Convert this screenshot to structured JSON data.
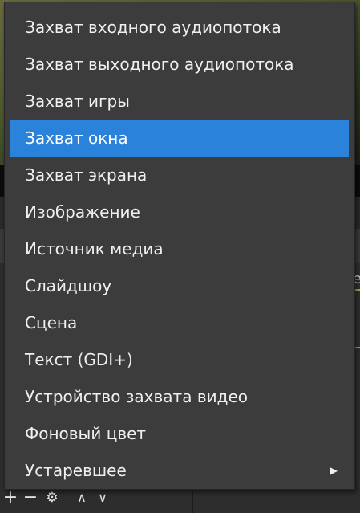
{
  "source_menu": {
    "items": [
      {
        "label": "Захват входного аудиопотока",
        "name": "menu-item-audio-input-capture"
      },
      {
        "label": "Захват выходного аудиопотока",
        "name": "menu-item-audio-output-capture"
      },
      {
        "label": "Захват игры",
        "name": "menu-item-game-capture"
      },
      {
        "label": "Захват окна",
        "name": "menu-item-window-capture"
      },
      {
        "label": "Захват экрана",
        "name": "menu-item-display-capture"
      },
      {
        "label": "Изображение",
        "name": "menu-item-image"
      },
      {
        "label": "Источник медиа",
        "name": "menu-item-media-source"
      },
      {
        "label": "Слайдшоу",
        "name": "menu-item-slideshow"
      },
      {
        "label": "Сцена",
        "name": "menu-item-scene"
      },
      {
        "label": "Текст (GDI+)",
        "name": "menu-item-text-gdi"
      },
      {
        "label": "Устройство захвата видео",
        "name": "menu-item-video-capture-device"
      },
      {
        "label": "Фоновый цвет",
        "name": "menu-item-color-source"
      },
      {
        "label": "Устаревшее",
        "name": "menu-item-deprecated",
        "submenu": true
      }
    ],
    "highlighted_index": 3,
    "submenu_arrow": "▶"
  },
  "toolbar": {
    "add_icon": "+",
    "remove_icon": "−",
    "settings_icon": "⚙",
    "up_icon": "∧",
    "down_icon": "∨"
  },
  "background": {
    "peek_text": "e"
  },
  "colors": {
    "menu_bg": "#3c3c3c",
    "highlight": "#2a82da",
    "text": "#f0f0f0"
  }
}
